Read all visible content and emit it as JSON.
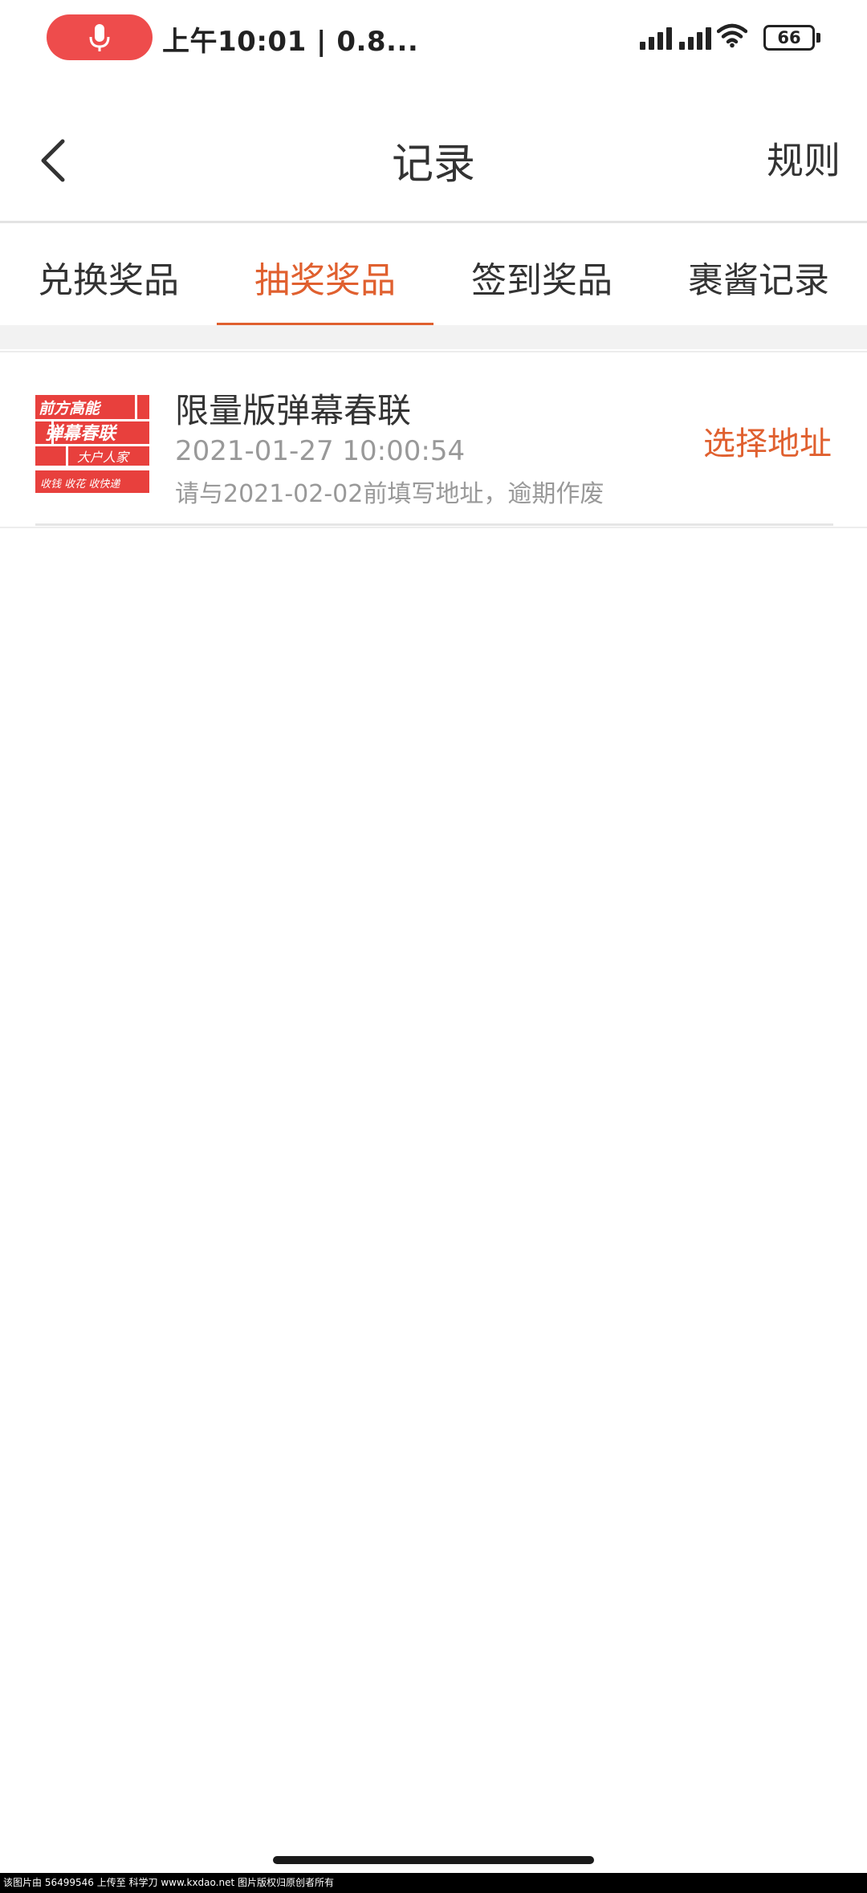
{
  "status_bar": {
    "time": "上午10:01 | 0.8...",
    "battery": "66",
    "icons": [
      "microphone-icon",
      "signal-icon",
      "signal-icon",
      "wifi-icon",
      "battery-icon"
    ],
    "mic_pill_color": "#ee4c4c"
  },
  "nav": {
    "title": "记录",
    "rules_label": "规则",
    "back_icon": "chevron-left-icon"
  },
  "tabs": [
    {
      "label": "兑换奖品",
      "active": false
    },
    {
      "label": "抽奖奖品",
      "active": true
    },
    {
      "label": "签到奖品",
      "active": false
    },
    {
      "label": "裹酱记录",
      "active": false
    }
  ],
  "prizes": [
    {
      "name": "限量版弹幕春联",
      "time": "2021-01-27 10:00:54",
      "note": "请与2021-02-02前填写地址，逾期作废",
      "action_label": "选择地址",
      "thumb": {
        "line1": "前方高能",
        "line2": "弹幕春联",
        "line3": "大户人家",
        "line4": "收钱 收花 收快递"
      }
    }
  ],
  "colors": {
    "accent": "#e0602f",
    "thumb_red": "#e8403d",
    "text_primary": "#333333",
    "text_secondary": "#999999"
  },
  "watermark": "该图片由 56499546 上传至 科学刀 www.kxdao.net 图片版权归原创者所有"
}
